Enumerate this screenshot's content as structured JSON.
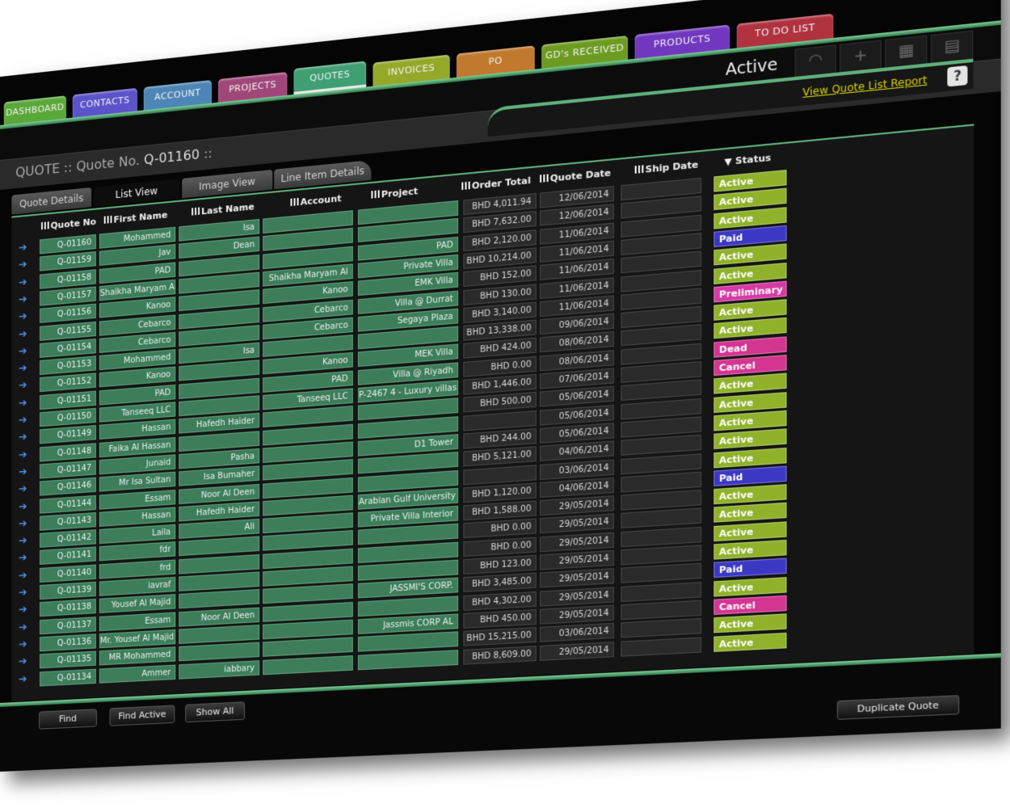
{
  "nav": [
    {
      "label": "DASHBOARD",
      "color": "#5aa83a"
    },
    {
      "label": "CONTACTS",
      "color": "#5b53c9"
    },
    {
      "label": "ACCOUNT",
      "color": "#4d86b6"
    },
    {
      "label": "PROJECTS",
      "color": "#a0477a"
    },
    {
      "label": "QUOTES",
      "color": "#3f9f72",
      "active": true
    },
    {
      "label": "INVOICES",
      "color": "#95a82a"
    },
    {
      "label": "PO",
      "color": "#c1792e"
    },
    {
      "label": "GD's RECEIVED",
      "color": "#6d9b22"
    },
    {
      "label": "PRODUCTS",
      "color": "#7138bf"
    },
    {
      "label": "TO DO LIST",
      "color": "#b0323f"
    }
  ],
  "header": {
    "active_label": "Active",
    "title_prefix": "QUOTE :: Quote No.",
    "quote_no": "Q-01160",
    "title_suffix": "::"
  },
  "report_link": "View Quote List Report",
  "help": "?",
  "subtabs": [
    "Quote Details",
    "List View",
    "Image View",
    "Line Item Details"
  ],
  "columns": [
    "Quote No",
    "First Name",
    "Last Name",
    "Account",
    "Project",
    "Order Total",
    "Quote Date",
    "Ship Date",
    "Status"
  ],
  "status_colors": {
    "Active": "#8fb22a",
    "Paid": "#3b39c4",
    "Preliminary": "#d73aa3",
    "Dead": "#d43591",
    "Cancel": "#d43591"
  },
  "rows": [
    {
      "quote": "Q-01160",
      "first": "Mohammed",
      "last": "Isa",
      "account": "",
      "project": "",
      "total": "BHD 4,011.94",
      "date": "12/06/2014",
      "ship": "",
      "status": "Active"
    },
    {
      "quote": "Q-01159",
      "first": "Jav",
      "last": "Dean",
      "account": "",
      "project": "",
      "total": "BHD 7,632.00",
      "date": "12/06/2014",
      "ship": "",
      "status": "Active"
    },
    {
      "quote": "Q-01158",
      "first": "PAD",
      "last": "",
      "account": "",
      "project": "PAD",
      "total": "BHD 2,120.00",
      "date": "11/06/2014",
      "ship": "",
      "status": "Active"
    },
    {
      "quote": "Q-01157",
      "first": "Shaikha Maryam Al",
      "last": "",
      "account": "Shaikha Maryam Al",
      "project": "Private Villa",
      "total": "BHD 10,214.00",
      "date": "11/06/2014",
      "ship": "",
      "status": "Paid"
    },
    {
      "quote": "Q-01156",
      "first": "Kanoo",
      "last": "",
      "account": "Kanoo",
      "project": "EMK Villa",
      "total": "BHD 152.00",
      "date": "11/06/2014",
      "ship": "",
      "status": "Active"
    },
    {
      "quote": "Q-01155",
      "first": "Cebarco",
      "last": "",
      "account": "Cebarco",
      "project": "Villa @ Durrat",
      "total": "BHD 130.00",
      "date": "11/06/2014",
      "ship": "",
      "status": "Active"
    },
    {
      "quote": "Q-01154",
      "first": "Cebarco",
      "last": "",
      "account": "Cebarco",
      "project": "Segaya Plaza",
      "total": "BHD 3,140.00",
      "date": "11/06/2014",
      "ship": "",
      "status": "Preliminary"
    },
    {
      "quote": "Q-01153",
      "first": "Mohammed",
      "last": "Isa",
      "account": "",
      "project": "",
      "total": "BHD 13,338.00",
      "date": "09/06/2014",
      "ship": "",
      "status": "Active"
    },
    {
      "quote": "Q-01152",
      "first": "Kanoo",
      "last": "",
      "account": "Kanoo",
      "project": "MEK Villa",
      "total": "BHD 424.00",
      "date": "08/06/2014",
      "ship": "",
      "status": "Active"
    },
    {
      "quote": "Q-01151",
      "first": "PAD",
      "last": "",
      "account": "PAD",
      "project": "Villa @ Riyadh",
      "total": "BHD 0.00",
      "date": "08/06/2014",
      "ship": "",
      "status": "Dead"
    },
    {
      "quote": "Q-01150",
      "first": "Tanseeq LLC",
      "last": "",
      "account": "Tanseeq LLC",
      "project": "P-2467 4 - Luxury villas",
      "total": "BHD 1,446.00",
      "date": "07/06/2014",
      "ship": "",
      "status": "Cancel"
    },
    {
      "quote": "Q-01149",
      "first": "Hassan",
      "last": "Hafedh Haider",
      "account": "",
      "project": "",
      "total": "BHD 500.00",
      "date": "05/06/2014",
      "ship": "",
      "status": "Active"
    },
    {
      "quote": "Q-01148",
      "first": "Faika Al Hassan",
      "last": "",
      "account": "",
      "project": "",
      "total": "",
      "date": "05/06/2014",
      "ship": "",
      "status": "Active"
    },
    {
      "quote": "Q-01147",
      "first": "Junaid",
      "last": "Pasha",
      "account": "",
      "project": "D1 Tower",
      "total": "BHD 244.00",
      "date": "05/06/2014",
      "ship": "",
      "status": "Active"
    },
    {
      "quote": "Q-01146",
      "first": "Mr Isa Sultan",
      "last": "Isa Bumaher",
      "account": "",
      "project": "",
      "total": "BHD 5,121.00",
      "date": "04/06/2014",
      "ship": "",
      "status": "Active"
    },
    {
      "quote": "Q-01144",
      "first": "Essam",
      "last": "Noor Al Deen",
      "account": "",
      "project": "",
      "total": "",
      "date": "03/06/2014",
      "ship": "",
      "status": "Active"
    },
    {
      "quote": "Q-01143",
      "first": "Hassan",
      "last": "Hafedh Haider",
      "account": "",
      "project": "Arabian Gulf University",
      "total": "BHD 1,120.00",
      "date": "04/06/2014",
      "ship": "",
      "status": "Paid"
    },
    {
      "quote": "Q-01142",
      "first": "Laila",
      "last": "Ali",
      "account": "",
      "project": "Private Villa Interior",
      "total": "BHD 1,588.00",
      "date": "29/05/2014",
      "ship": "",
      "status": "Active"
    },
    {
      "quote": "Q-01141",
      "first": "fdr",
      "last": "",
      "account": "",
      "project": "",
      "total": "BHD 0.00",
      "date": "29/05/2014",
      "ship": "",
      "status": "Active"
    },
    {
      "quote": "Q-01140",
      "first": "frd",
      "last": "",
      "account": "",
      "project": "",
      "total": "BHD 0.00",
      "date": "29/05/2014",
      "ship": "",
      "status": "Active"
    },
    {
      "quote": "Q-01139",
      "first": "iavraf",
      "last": "",
      "account": "",
      "project": "",
      "total": "BHD 123.00",
      "date": "29/05/2014",
      "ship": "",
      "status": "Active"
    },
    {
      "quote": "Q-01138",
      "first": "Yousef Al Majid",
      "last": "",
      "account": "",
      "project": "JASSMI'S CORP.",
      "total": "BHD 3,485.00",
      "date": "29/05/2014",
      "ship": "",
      "status": "Paid"
    },
    {
      "quote": "Q-01137",
      "first": "Essam",
      "last": "Noor Al Deen",
      "account": "",
      "project": "",
      "total": "BHD 4,302.00",
      "date": "29/05/2014",
      "ship": "",
      "status": "Active"
    },
    {
      "quote": "Q-01136",
      "first": "Mr. Yousef Al Majid",
      "last": "",
      "account": "",
      "project": "Jassmis CORP AL",
      "total": "BHD 450.00",
      "date": "29/05/2014",
      "ship": "",
      "status": "Cancel"
    },
    {
      "quote": "Q-01135",
      "first": "MR Mohammed",
      "last": "",
      "account": "",
      "project": "",
      "total": "BHD 15,215.00",
      "date": "03/06/2014",
      "ship": "",
      "status": "Active"
    },
    {
      "quote": "Q-01134",
      "first": "Ammer",
      "last": "iabbary",
      "account": "",
      "project": "",
      "total": "BHD 8,609.00",
      "date": "29/05/2014",
      "ship": "",
      "status": "Active"
    }
  ],
  "buttons": {
    "find": "Find",
    "find_active": "Find Active",
    "show_all": "Show All",
    "duplicate": "Duplicate Quote"
  }
}
